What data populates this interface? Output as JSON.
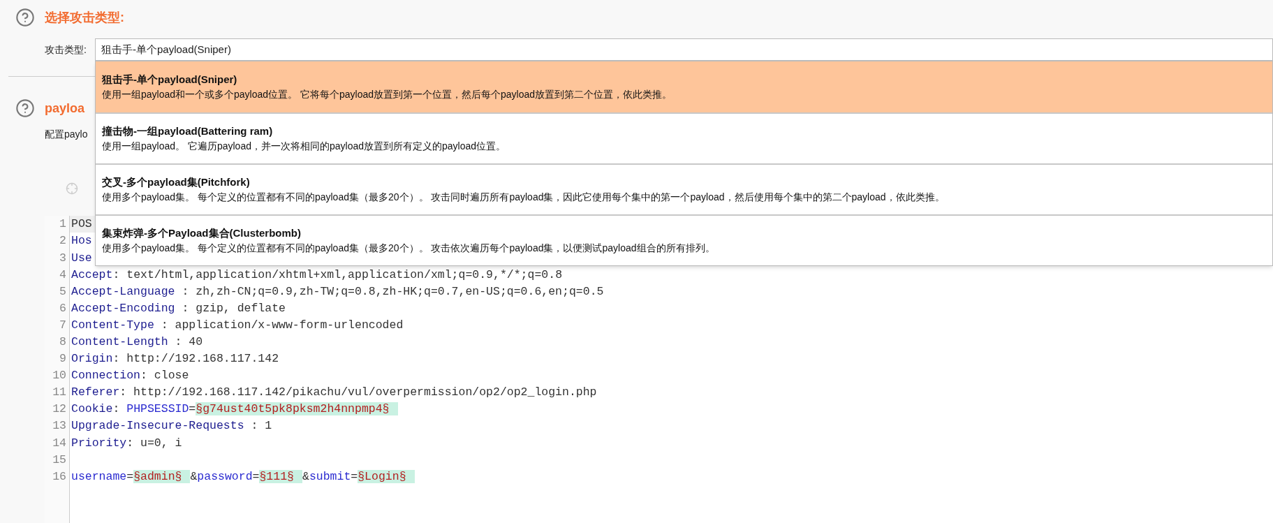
{
  "attack_section": {
    "title": "选择攻击类型:",
    "field_label": "攻击类型:",
    "value": "狙击手-单个payload(Sniper)"
  },
  "dropdown": {
    "options": [
      {
        "title": "狙击手-单个payload(Sniper)",
        "description": "使用一组payload和一个或多个payload位置。 它将每个payload放置到第一个位置，然后每个payload放置到第二个位置，依此类推。",
        "selected": true
      },
      {
        "title": "撞击物-一组payload(Battering ram)",
        "description": "使用一组payload。 它遍历payload，并一次将相同的payload放置到所有定义的payload位置。",
        "selected": false
      },
      {
        "title": "交叉-多个payload集(Pitchfork)",
        "description": "使用多个payload集。 每个定义的位置都有不同的payload集（最多20个）。 攻击同时遍历所有payload集，因此它使用每个集中的第一个payload，然后使用每个集中的第二个payload，依此类推。",
        "selected": false
      },
      {
        "title": "集束炸弹-多个Payload集合(Clusterbomb)",
        "description": "使用多个payload集。 每个定义的位置都有不同的payload集（最多20个）。 攻击依次遍历每个payload集，以便测试payload组合的所有排列。",
        "selected": false
      }
    ]
  },
  "payload_section": {
    "title": "payloa",
    "description": "配置paylo"
  },
  "editor": {
    "lines": [
      {
        "number": "1",
        "current": true,
        "segments": [
          {
            "kind": "text",
            "text": "POS"
          }
        ]
      },
      {
        "number": "2",
        "current": false,
        "segments": [
          {
            "kind": "name",
            "text": "Hos"
          }
        ]
      },
      {
        "number": "3",
        "current": false,
        "segments": [
          {
            "kind": "name",
            "text": "Use"
          }
        ]
      },
      {
        "number": "4",
        "current": false,
        "segments": [
          {
            "kind": "name",
            "text": "Accept"
          },
          {
            "kind": "text",
            "text": ": text/html,application/xhtml+xml,application/xml;q=0.9,*/*;q=0.8"
          }
        ]
      },
      {
        "number": "5",
        "current": false,
        "segments": [
          {
            "kind": "name",
            "text": "Accept-Language"
          },
          {
            "kind": "text",
            "text": " : zh,zh-CN;q=0.9,zh-TW;q=0.8,zh-HK;q=0.7,en-US;q=0.6,en;q=0.5"
          }
        ]
      },
      {
        "number": "6",
        "current": false,
        "segments": [
          {
            "kind": "name",
            "text": "Accept-Encoding"
          },
          {
            "kind": "text",
            "text": " : gzip, deflate"
          }
        ]
      },
      {
        "number": "7",
        "current": false,
        "segments": [
          {
            "kind": "name",
            "text": "Content-Type"
          },
          {
            "kind": "text",
            "text": " : application/x-www-form-urlencoded"
          }
        ]
      },
      {
        "number": "8",
        "current": false,
        "segments": [
          {
            "kind": "name",
            "text": "Content-Length"
          },
          {
            "kind": "text",
            "text": " : 40"
          }
        ]
      },
      {
        "number": "9",
        "current": false,
        "segments": [
          {
            "kind": "name",
            "text": "Origin"
          },
          {
            "kind": "text",
            "text": ": http://192.168.117.142"
          }
        ]
      },
      {
        "number": "10",
        "current": false,
        "segments": [
          {
            "kind": "name",
            "text": "Connection"
          },
          {
            "kind": "text",
            "text": ": close"
          }
        ]
      },
      {
        "number": "11",
        "current": false,
        "segments": [
          {
            "kind": "name",
            "text": "Referer"
          },
          {
            "kind": "text",
            "text": ": http://192.168.117.142/pikachu/vul/overpermission/op2/op2_login.php"
          }
        ]
      },
      {
        "number": "12",
        "current": false,
        "segments": [
          {
            "kind": "name",
            "text": "Cookie"
          },
          {
            "kind": "text",
            "text": ": "
          },
          {
            "kind": "param",
            "text": "PHPSESSID"
          },
          {
            "kind": "text",
            "text": "="
          },
          {
            "kind": "marker",
            "text": "§g74ust40t5pk8pksm2h4nnpmp4§"
          }
        ]
      },
      {
        "number": "13",
        "current": false,
        "segments": [
          {
            "kind": "name",
            "text": "Upgrade-Insecure-Requests"
          },
          {
            "kind": "text",
            "text": " : 1"
          }
        ]
      },
      {
        "number": "14",
        "current": false,
        "segments": [
          {
            "kind": "name",
            "text": "Priority"
          },
          {
            "kind": "text",
            "text": ": u=0, i"
          }
        ]
      },
      {
        "number": "15",
        "current": false
      },
      {
        "number": "16",
        "current": false,
        "segments": [
          {
            "kind": "param",
            "text": "username"
          },
          {
            "kind": "text",
            "text": "="
          },
          {
            "kind": "marker",
            "text": "§admin§"
          },
          {
            "kind": "text",
            "text": "&"
          },
          {
            "kind": "param",
            "text": "password"
          },
          {
            "kind": "text",
            "text": "="
          },
          {
            "kind": "marker",
            "text": "§111§"
          },
          {
            "kind": "text",
            "text": "&"
          },
          {
            "kind": "param",
            "text": "submit"
          },
          {
            "kind": "text",
            "text": "="
          },
          {
            "kind": "marker",
            "text": "§Login§"
          }
        ]
      }
    ]
  }
}
